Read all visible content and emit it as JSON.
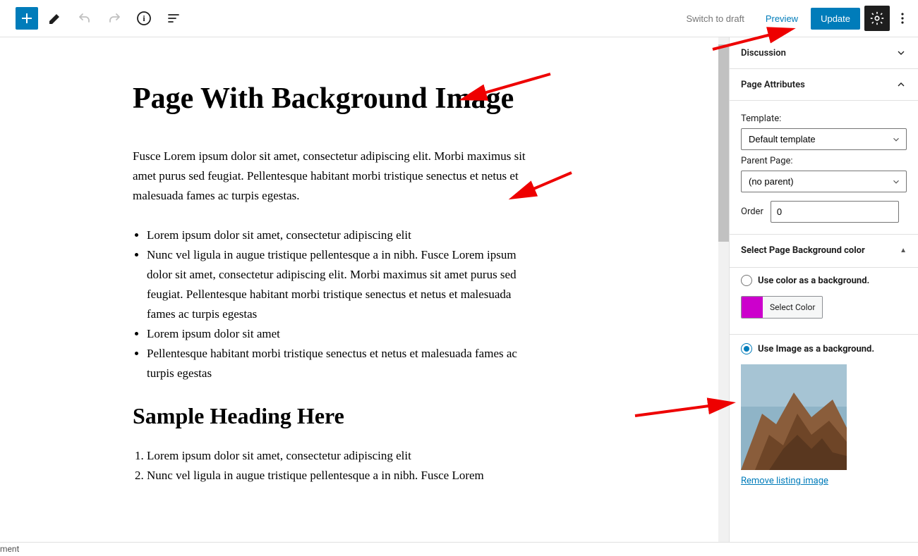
{
  "topbar": {
    "switch_to_draft": "Switch to draft",
    "preview": "Preview",
    "update": "Update"
  },
  "content": {
    "title": "Page With Background Image",
    "paragraph1": "Fusce Lorem ipsum dolor sit amet, consectetur adipiscing elit. Morbi maximus sit amet purus sed feugiat. Pellentesque habitant morbi tristique senectus et netus et malesuada fames ac turpis egestas.",
    "ul": [
      "Lorem ipsum dolor sit amet, consectetur adipiscing elit",
      "Nunc vel ligula in augue tristique pellentesque a in nibh. Fusce Lorem ipsum dolor sit amet, consectetur adipiscing elit. Morbi maximus sit amet purus sed feugiat. Pellentesque habitant morbi tristique senectus et netus et malesuada fames ac turpis egestas",
      "Lorem ipsum dolor sit amet",
      "Pellentesque habitant morbi tristique senectus et netus et malesuada fames ac turpis egestas"
    ],
    "heading2": "Sample Heading Here",
    "ol": [
      "Lorem ipsum dolor sit amet, consectetur adipiscing elit",
      "Nunc vel ligula in augue tristique pellentesque a in nibh. Fusce Lorem"
    ]
  },
  "sidebar": {
    "discussion": {
      "title": "Discussion"
    },
    "page_attributes": {
      "title": "Page Attributes",
      "template_label": "Template:",
      "template_value": "Default template",
      "parent_label": "Parent Page:",
      "parent_value": "(no parent)",
      "order_label": "Order",
      "order_value": "0"
    },
    "bg_section": {
      "title": "Select Page Background color",
      "use_color_label": "Use color as a background.",
      "swatch_color": "#cc00cc",
      "select_color_btn": "Select Color",
      "use_image_label": "Use Image as a background.",
      "remove_link": "Remove listing image"
    }
  },
  "footer": {
    "text": "ment"
  }
}
